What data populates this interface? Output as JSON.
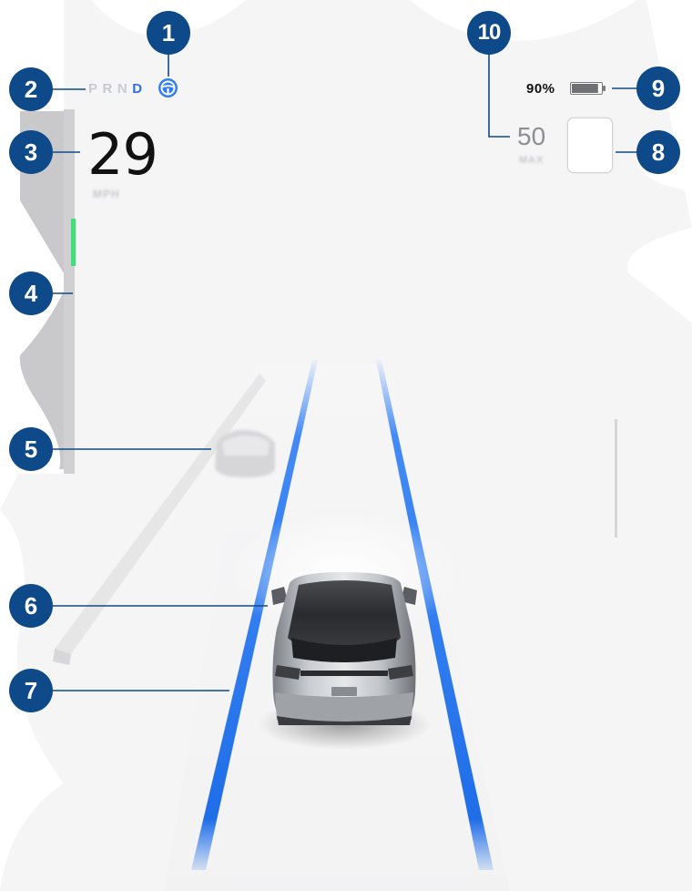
{
  "drive_display": {
    "gear_selector": {
      "gears": [
        "P",
        "R",
        "N",
        "D"
      ],
      "selected": "D"
    },
    "autosteer_icon": "steering-wheel-icon",
    "speed": {
      "value": "29",
      "unit": "MPH"
    },
    "battery": {
      "percent_label": "90%",
      "level": 0.9
    },
    "speed_limit": {
      "value": "50",
      "unit": "MAX"
    }
  },
  "callouts": [
    "1",
    "2",
    "3",
    "4",
    "5",
    "6",
    "7",
    "8",
    "9",
    "10"
  ],
  "colors": {
    "callout_fill": "#0e4a8a",
    "lane_blue": "#2f7ef5",
    "selected_gear": "#2f6fe0",
    "blind_spot_green": "#3fe07a"
  }
}
